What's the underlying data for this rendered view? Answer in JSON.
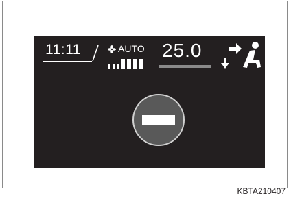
{
  "display": {
    "clock": "11:11",
    "fan_mode": "AUTO",
    "fan_speed_level": 4,
    "fan_speed_max": 7,
    "temperature": "25.0"
  },
  "icons": {
    "fan": "fan-icon",
    "airflow": "airflow-mode-icon",
    "down_arrow": "down-arrow-icon",
    "minus": "minus-icon"
  },
  "colors": {
    "screen_background": "#231f20",
    "text": "#ffffff",
    "button_fill": "#595959",
    "accent_gray": "#8a8a8a"
  },
  "caption": "KBTA210407"
}
